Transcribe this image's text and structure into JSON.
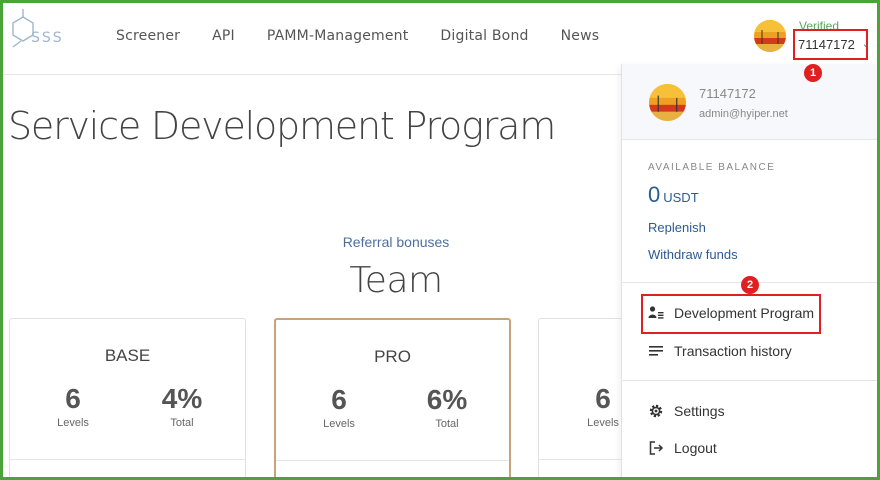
{
  "header": {
    "logo_text": "SSS",
    "nav": [
      "Screener",
      "API",
      "PAMM-Management",
      "Digital Bond",
      "News"
    ],
    "user": {
      "verified_label": "Verified",
      "id": "71147172",
      "chevron": "⌄"
    }
  },
  "annotations": {
    "badge1": "1",
    "badge2": "2"
  },
  "main": {
    "title": "Service Development Program",
    "referral_label": "Referral bonuses",
    "team_title": "Team",
    "cards": [
      {
        "name": "BASE",
        "levels": "6",
        "levels_label": "Levels",
        "total": "4%",
        "total_label": "Total"
      },
      {
        "name": "PRO",
        "levels": "6",
        "levels_label": "Levels",
        "total": "6%",
        "total_label": "Total"
      },
      {
        "name": "",
        "levels": "6",
        "levels_label": "Levels",
        "total": "",
        "total_label": ""
      }
    ]
  },
  "dropdown": {
    "user_name": "71147172",
    "email": "admin@hyiper.net",
    "balance_label": "AVAILABLE BALANCE",
    "balance_amount": "0",
    "balance_currency": "USDT",
    "replenish": "Replenish",
    "withdraw": "Withdraw funds",
    "items": [
      {
        "label": "Development Program",
        "icon": "user-list-icon"
      },
      {
        "label": "Transaction history",
        "icon": "list-lines-icon"
      },
      {
        "label": "Settings",
        "icon": "gear-icon"
      },
      {
        "label": "Logout",
        "icon": "logout-icon"
      }
    ]
  },
  "colors": {
    "accent_blue": "#2b5b94",
    "highlight_red": "#e02020",
    "frame_green": "#4aa43a",
    "pro_border": "#c8a27a"
  }
}
